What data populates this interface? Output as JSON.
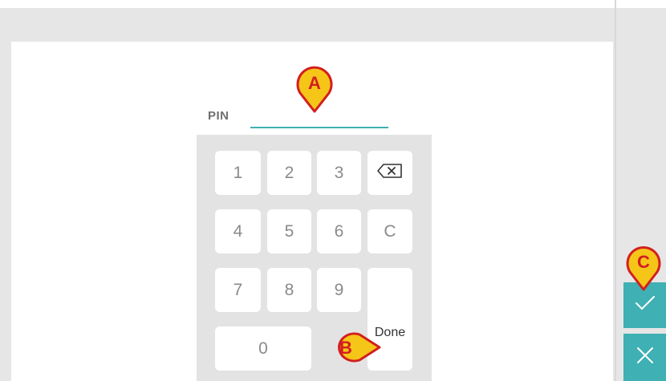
{
  "window": {
    "accent": "#3fb0b3",
    "background": "#e6e6e6"
  },
  "pin": {
    "label": "PIN",
    "value": "",
    "placeholder": ""
  },
  "keypad": {
    "row1": [
      "1",
      "2",
      "3"
    ],
    "row2": [
      "4",
      "5",
      "6"
    ],
    "row3": [
      "7",
      "8",
      "9"
    ],
    "zero": "0",
    "clear": "C",
    "done": "Done",
    "backspace_icon": "backspace-icon"
  },
  "actions": {
    "confirm_icon": "checkmark-icon",
    "cancel_icon": "close-icon"
  },
  "annotations": {
    "a": "A",
    "b": "B",
    "c": "C",
    "fill": "#f5c518",
    "stroke": "#d21f1f"
  }
}
